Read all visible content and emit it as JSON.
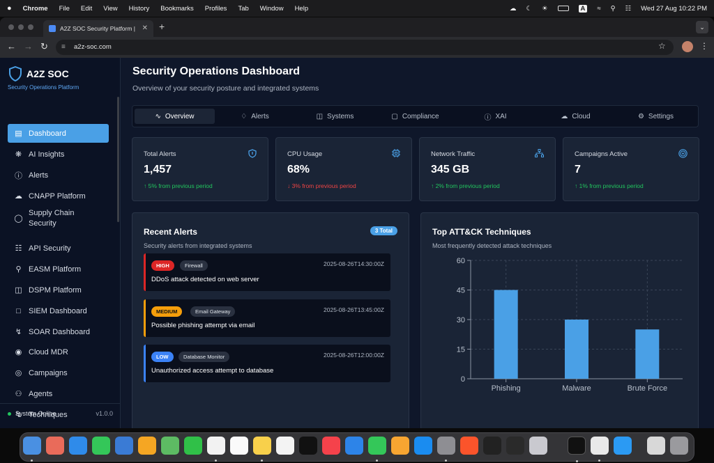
{
  "menubar": {
    "apple": "",
    "app": "Chrome",
    "items": [
      "File",
      "Edit",
      "View",
      "History",
      "Bookmarks",
      "Profiles",
      "Tab",
      "Window",
      "Help"
    ],
    "input_indicator": "A",
    "clock": "Wed 27 Aug  10:22 PM"
  },
  "browser": {
    "tab_title": "A2Z SOC Security Platform | ",
    "url": "a2z-soc.com"
  },
  "sidebar": {
    "brand": "A2Z SOC",
    "tagline": "Security Operations Platform",
    "items": [
      {
        "label": "Dashboard",
        "icon": "dashboard-icon"
      },
      {
        "label": "AI Insights",
        "icon": "brain-icon"
      },
      {
        "label": "Alerts",
        "icon": "alert-circle-icon"
      },
      {
        "label": "CNAPP Platform",
        "icon": "cloud-icon"
      },
      {
        "label": "Supply Chain Security",
        "icon": "shield-icon"
      },
      {
        "label": "API Security",
        "icon": "network-icon"
      },
      {
        "label": "EASM Platform",
        "icon": "search-icon"
      },
      {
        "label": "DSPM Platform",
        "icon": "database-icon"
      },
      {
        "label": "SIEM Dashboard",
        "icon": "monitor-icon"
      },
      {
        "label": "SOAR Dashboard",
        "icon": "zap-icon"
      },
      {
        "label": "Cloud MDR",
        "icon": "eye-icon"
      },
      {
        "label": "Campaigns",
        "icon": "target-icon"
      },
      {
        "label": "Agents",
        "icon": "users-icon"
      },
      {
        "label": "Techniques",
        "icon": "zap-icon"
      }
    ],
    "status": "System Online",
    "version": "v1.0.0"
  },
  "main": {
    "title": "Security Operations Dashboard",
    "subtitle": "Overview of your security posture and integrated systems",
    "tabs": [
      {
        "label": "Overview",
        "icon": "activity-icon"
      },
      {
        "label": "Alerts",
        "icon": "bell-icon"
      },
      {
        "label": "Systems",
        "icon": "database-icon"
      },
      {
        "label": "Compliance",
        "icon": "file-icon"
      },
      {
        "label": "XAI",
        "icon": "info-icon"
      },
      {
        "label": "Cloud",
        "icon": "cloud-icon"
      },
      {
        "label": "Settings",
        "icon": "gear-icon"
      }
    ],
    "stats": [
      {
        "label": "Total Alerts",
        "value": "1,457",
        "trend": "↑ 5% from previous period",
        "direction": "up",
        "icon": "shield-icon"
      },
      {
        "label": "CPU Usage",
        "value": "68%",
        "trend": "↓ 3% from previous period",
        "direction": "down",
        "icon": "cpu-icon"
      },
      {
        "label": "Network Traffic",
        "value": "345 GB",
        "trend": "↑ 2% from previous period",
        "direction": "up",
        "icon": "network-icon"
      },
      {
        "label": "Campaigns Active",
        "value": "7",
        "trend": "↑ 1% from previous period",
        "direction": "up",
        "icon": "target-icon"
      }
    ],
    "recent_alerts": {
      "title": "Recent Alerts",
      "badge": "3 Total",
      "subtitle": "Security alerts from integrated systems",
      "items": [
        {
          "severity": "HIGH",
          "source": "Firewall",
          "timestamp": "2025-08-26T14:30:00Z",
          "message": "DDoS attack detected on web server",
          "color": "#dc2626"
        },
        {
          "severity": "MEDIUM",
          "source": "Email Gateway",
          "timestamp": "2025-08-26T13:45:00Z",
          "message": "Possible phishing attempt via email",
          "color": "#f59e0b"
        },
        {
          "severity": "LOW",
          "source": "Database Monitor",
          "timestamp": "2025-08-26T12:00:00Z",
          "message": "Unauthorized access attempt to database",
          "color": "#3b82f6"
        }
      ]
    },
    "techniques": {
      "title": "Top ATT&CK Techniques",
      "subtitle": "Most frequently detected attack techniques"
    }
  },
  "chart_data": {
    "type": "bar",
    "categories": [
      "Phishing",
      "Malware",
      "Brute Force"
    ],
    "values": [
      45,
      30,
      25
    ],
    "ylim": [
      0,
      60
    ],
    "yticks": [
      "0",
      "15",
      "30",
      "45",
      "60"
    ],
    "grid": true,
    "bar_color": "#4aa0e6"
  },
  "colors": {
    "accent": "#4aa0e6",
    "bg": "#0f172a",
    "card": "#1a2436",
    "up": "#22c55e",
    "down": "#ef4444"
  }
}
